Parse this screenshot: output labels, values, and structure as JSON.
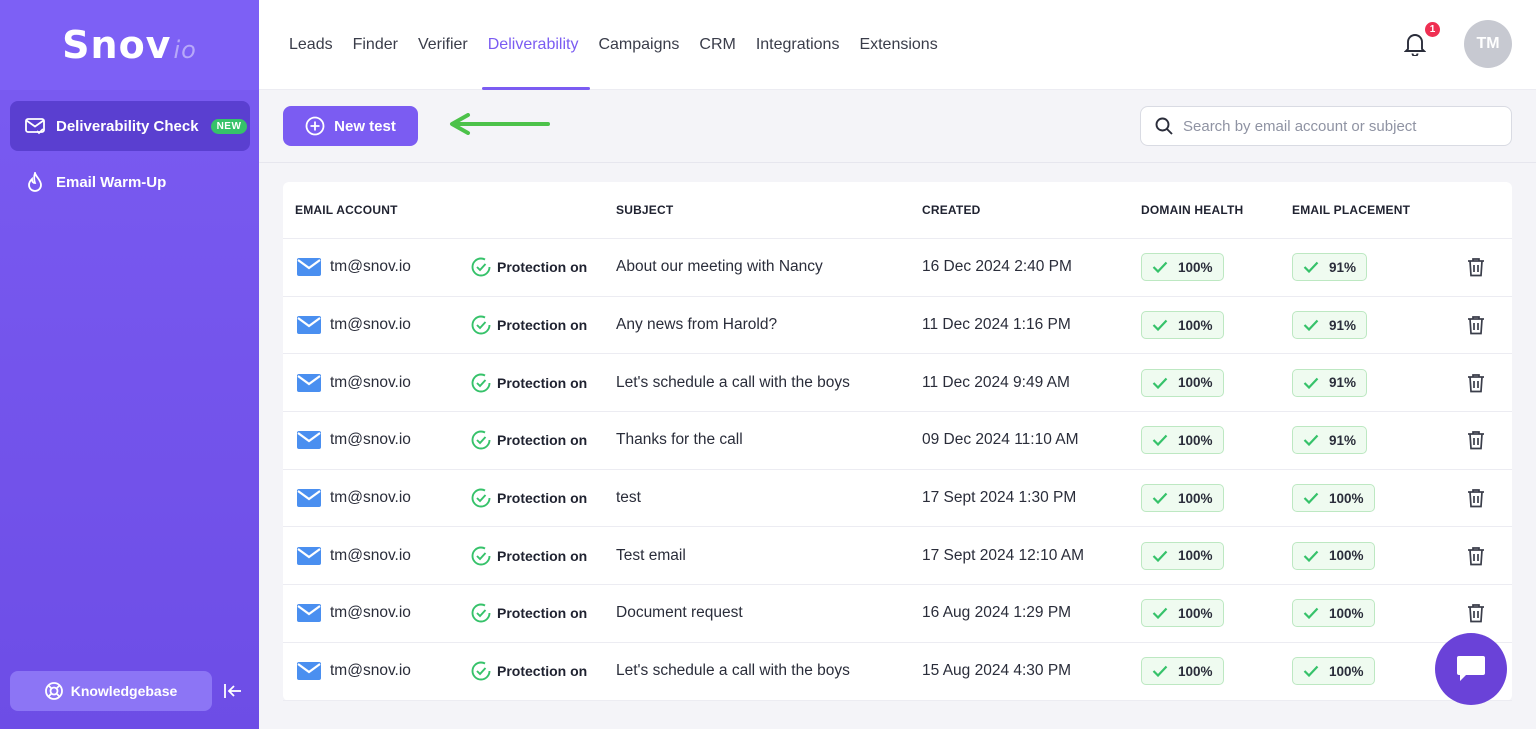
{
  "brand": {
    "main": "Snov",
    "suffix": "io"
  },
  "sidebar": {
    "items": [
      {
        "label": "Deliverability Check",
        "badge": "NEW",
        "icon": "mail-check-icon"
      },
      {
        "label": "Email Warm-Up",
        "icon": "flame-icon"
      }
    ],
    "knowledgebase": "Knowledgebase"
  },
  "nav": {
    "items": [
      "Leads",
      "Finder",
      "Verifier",
      "Deliverability",
      "Campaigns",
      "CRM",
      "Integrations",
      "Extensions"
    ],
    "active": "Deliverability"
  },
  "header": {
    "notification_count": "1",
    "avatar_initials": "TM"
  },
  "toolbar": {
    "new_test_label": "New test",
    "search_placeholder": "Search by email account or subject"
  },
  "table": {
    "headers": {
      "email_account": "EMAIL ACCOUNT",
      "subject": "SUBJECT",
      "created": "CREATED",
      "domain_health": "DOMAIN HEALTH",
      "email_placement": "EMAIL PLACEMENT"
    },
    "rows": [
      {
        "email": "tm@snov.io",
        "protection": "Protection on",
        "subject": "About our meeting with Nancy",
        "created": "16 Dec 2024 2:40 PM",
        "domain_health": "100%",
        "email_placement": "91%"
      },
      {
        "email": "tm@snov.io",
        "protection": "Protection on",
        "subject": "Any news from Harold?",
        "created": "11 Dec 2024 1:16 PM",
        "domain_health": "100%",
        "email_placement": "91%"
      },
      {
        "email": "tm@snov.io",
        "protection": "Protection on",
        "subject": "Let's schedule a call with the boys",
        "created": "11 Dec 2024 9:49 AM",
        "domain_health": "100%",
        "email_placement": "91%"
      },
      {
        "email": "tm@snov.io",
        "protection": "Protection on",
        "subject": "Thanks for the call",
        "created": "09 Dec 2024 11:10 AM",
        "domain_health": "100%",
        "email_placement": "91%"
      },
      {
        "email": "tm@snov.io",
        "protection": "Protection on",
        "subject": "test",
        "created": "17 Sept 2024 1:30 PM",
        "domain_health": "100%",
        "email_placement": "100%"
      },
      {
        "email": "tm@snov.io",
        "protection": "Protection on",
        "subject": "Test email",
        "created": "17 Sept 2024 12:10 AM",
        "domain_health": "100%",
        "email_placement": "100%"
      },
      {
        "email": "tm@snov.io",
        "protection": "Protection on",
        "subject": "Document request",
        "created": "16 Aug 2024 1:29 PM",
        "domain_health": "100%",
        "email_placement": "100%"
      },
      {
        "email": "tm@snov.io",
        "protection": "Protection on",
        "subject": "Let's schedule a call with the boys",
        "created": "15 Aug 2024 4:30 PM",
        "domain_health": "100%",
        "email_placement": "100%"
      }
    ]
  },
  "colors": {
    "accent": "#7b5cf2",
    "success": "#36c26a",
    "danger": "#ef2f52",
    "arrow": "#4cc24a"
  }
}
